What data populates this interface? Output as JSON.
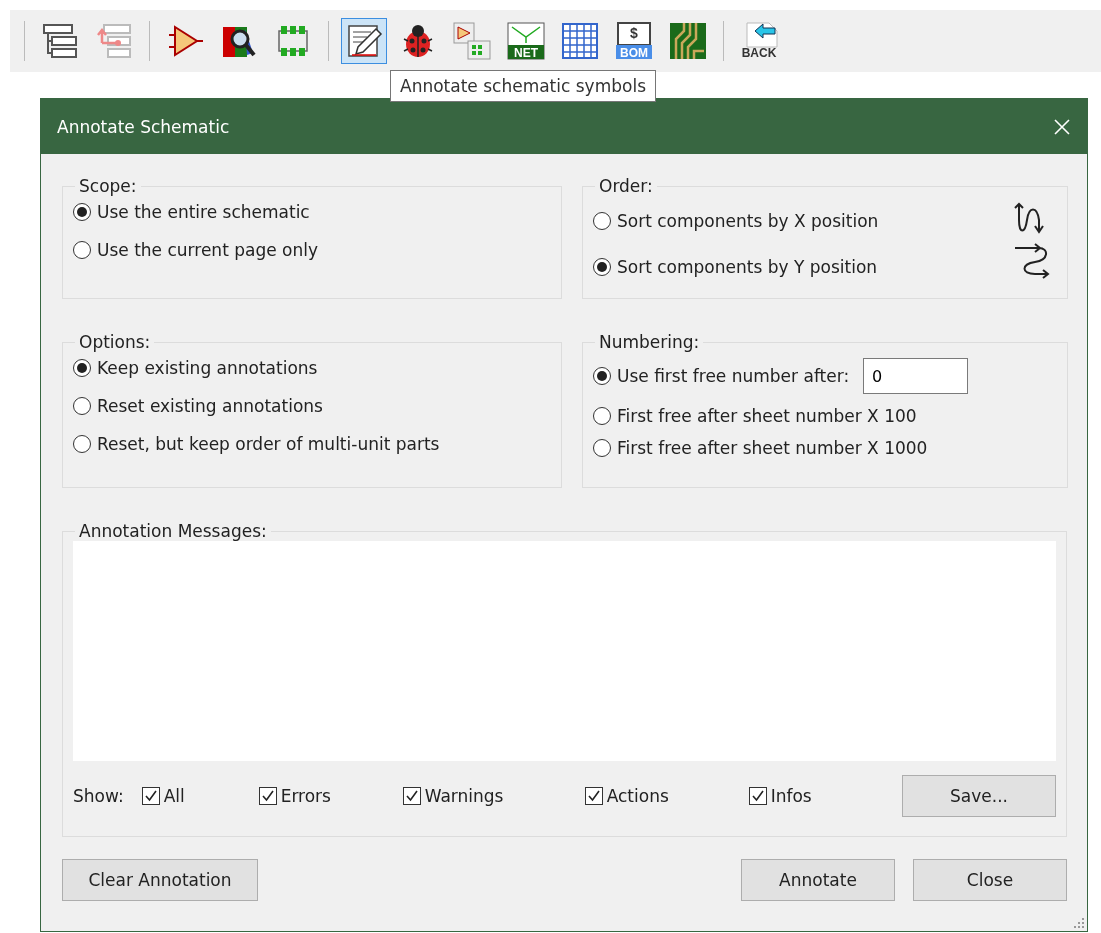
{
  "toolbar": [
    {
      "kind": "hierarchy",
      "selected": false
    },
    {
      "kind": "hierarchy-up",
      "selected": false
    },
    {
      "kind": "symbol-editor",
      "selected": false
    },
    {
      "kind": "library-browser",
      "selected": false
    },
    {
      "kind": "footprint",
      "selected": false
    },
    {
      "kind": "annotate",
      "selected": true
    },
    {
      "kind": "erc",
      "selected": false
    },
    {
      "kind": "assign-footprints",
      "selected": false
    },
    {
      "kind": "netlist",
      "selected": false,
      "label": "NET"
    },
    {
      "kind": "table",
      "selected": false
    },
    {
      "kind": "bom",
      "selected": false,
      "label": "BOM",
      "sign": "$"
    },
    {
      "kind": "pcb",
      "selected": false
    },
    {
      "kind": "back",
      "selected": false,
      "label": "BACK"
    }
  ],
  "tooltip": "Annotate schematic symbols",
  "dialog": {
    "title": "Annotate Schematic",
    "scope": {
      "title": "Scope:",
      "options": [
        {
          "label": "Use the entire schematic",
          "selected": true
        },
        {
          "label": "Use the current page only",
          "selected": false
        }
      ]
    },
    "order": {
      "title": "Order:",
      "options": [
        {
          "label": "Sort components by X position",
          "selected": false
        },
        {
          "label": "Sort components by Y position",
          "selected": true
        }
      ]
    },
    "options": {
      "title": "Options:",
      "options": [
        {
          "label": "Keep existing annotations",
          "selected": true
        },
        {
          "label": "Reset existing annotations",
          "selected": false
        },
        {
          "label": "Reset, but keep order of multi-unit parts",
          "selected": false
        }
      ]
    },
    "numbering": {
      "title": "Numbering:",
      "options": [
        {
          "label": "Use first free number after:",
          "selected": true,
          "value": "0"
        },
        {
          "label": "First free after sheet number X 100",
          "selected": false
        },
        {
          "label": "First free after sheet number X 1000",
          "selected": false
        }
      ]
    },
    "messages": {
      "title": "Annotation Messages:",
      "show_label": "Show:",
      "filters": [
        {
          "label": "All",
          "checked": true
        },
        {
          "label": "Errors",
          "checked": true
        },
        {
          "label": "Warnings",
          "checked": true
        },
        {
          "label": "Actions",
          "checked": true
        },
        {
          "label": "Infos",
          "checked": true
        }
      ],
      "save": "Save..."
    },
    "buttons": {
      "clear": "Clear Annotation",
      "annotate": "Annotate",
      "close": "Close"
    }
  }
}
